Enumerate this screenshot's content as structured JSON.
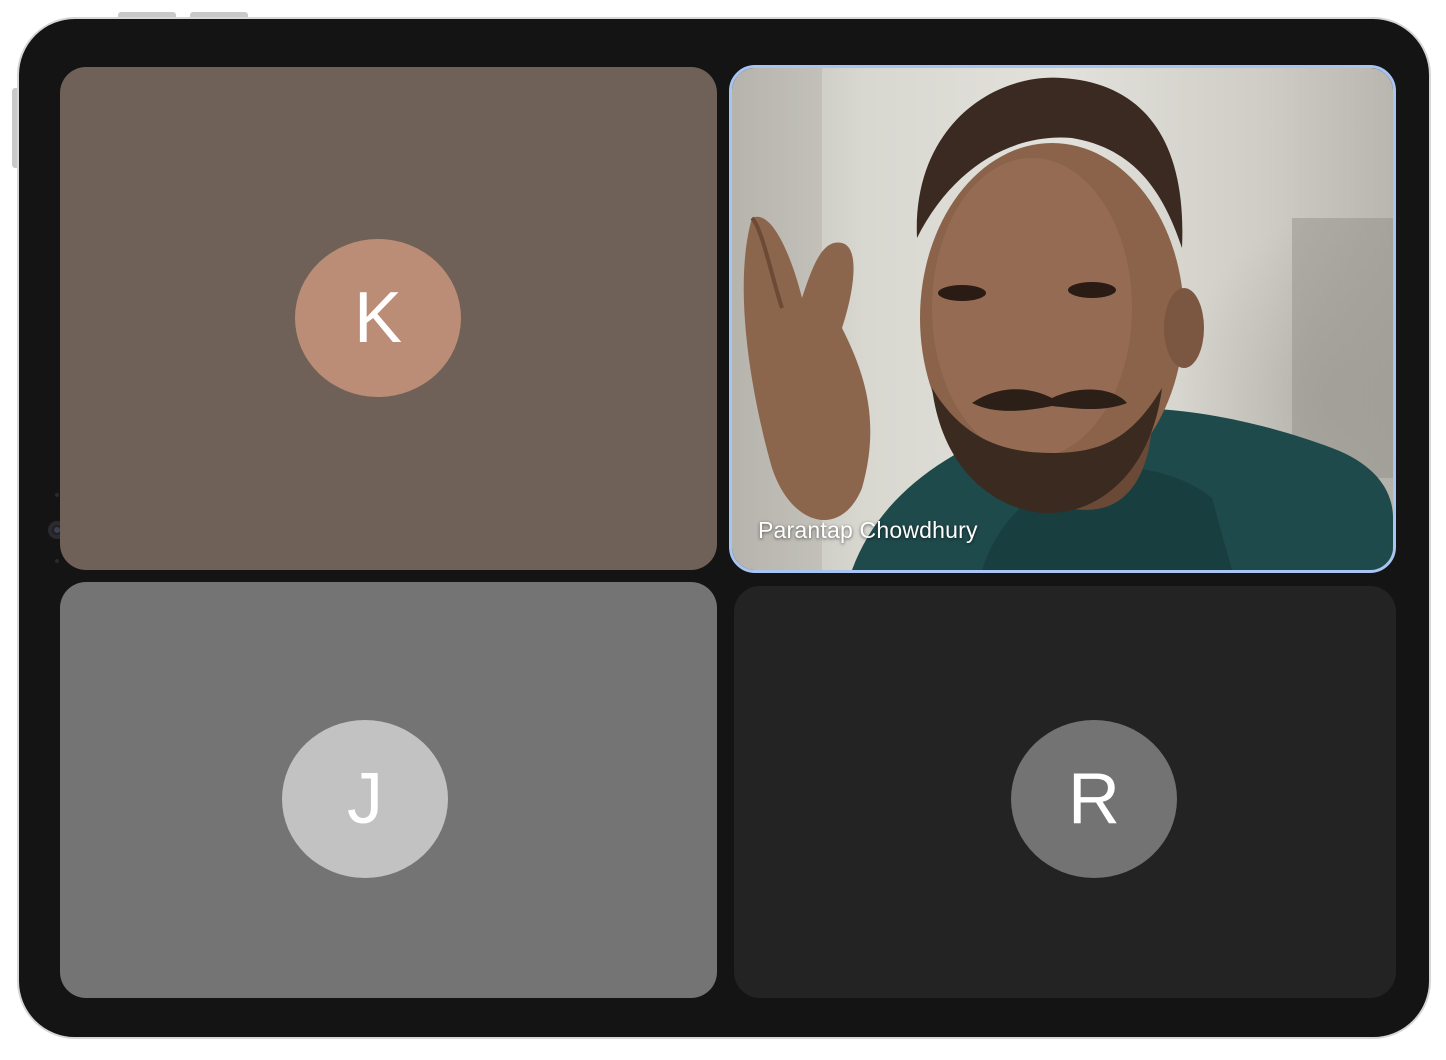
{
  "meeting": {
    "participants": [
      {
        "id": "k",
        "initial": "K",
        "tile_color": "#6f6158",
        "avatar_color": "#bb8d77",
        "video_on": false
      },
      {
        "id": "parantap",
        "name": "Parantap Chowdhury",
        "video_on": true,
        "active_speaker": true,
        "highlight_color": "#a8c4f2"
      },
      {
        "id": "j",
        "initial": "J",
        "tile_color": "#747474",
        "avatar_color": "#c2c2c2",
        "video_on": false
      },
      {
        "id": "r",
        "initial": "R",
        "tile_color": "#232323",
        "avatar_color": "#737373",
        "video_on": false
      }
    ]
  },
  "device": {
    "frame_color": "#141414",
    "bezel_edge_color": "#d6d6d8"
  }
}
